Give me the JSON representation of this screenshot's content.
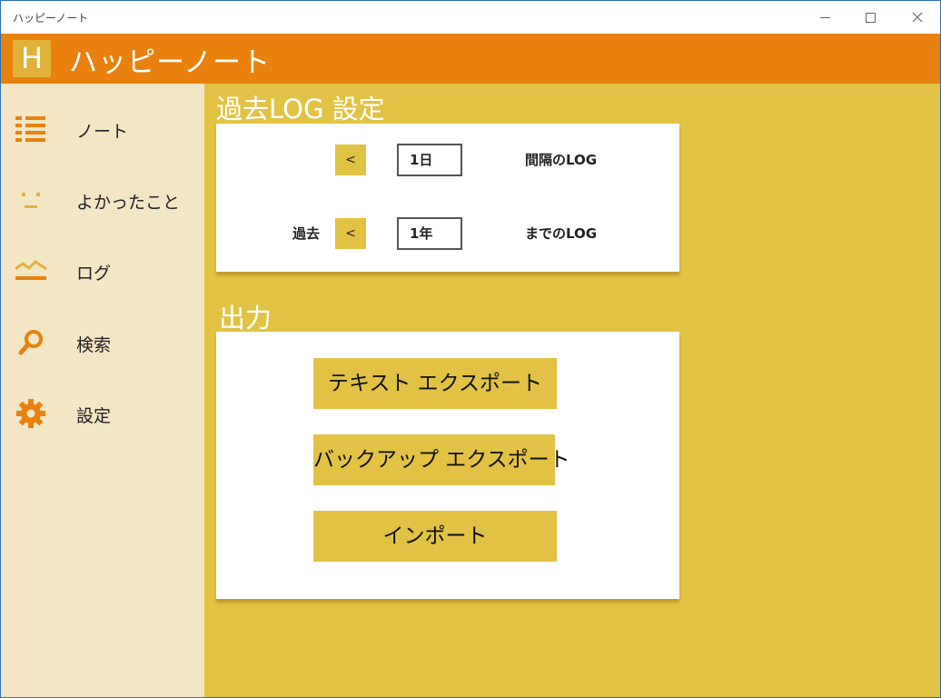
{
  "window": {
    "title": "ハッピーノート"
  },
  "app": {
    "logo_letter": "H",
    "title": "ハッピーノート"
  },
  "sidebar": {
    "items": [
      {
        "label": "ノート",
        "icon": "list-icon"
      },
      {
        "label": "よかったこと",
        "icon": "smile-icon"
      },
      {
        "label": "ログ",
        "icon": "chart-line-icon"
      },
      {
        "label": "検索",
        "icon": "search-icon"
      },
      {
        "label": "設定",
        "icon": "gear-icon"
      }
    ]
  },
  "log_settings": {
    "title": "過去LOG 設定",
    "interval": {
      "button": "<",
      "value": "1日",
      "label": "間隔のLOG"
    },
    "past": {
      "prefix": "過去",
      "button": "<",
      "value": "1年",
      "label": "までのLOG"
    }
  },
  "output": {
    "title": "出力",
    "text_export": "テキスト エクスポート",
    "backup_export": "バックアップ エクスポート",
    "import": "インポート"
  },
  "colors": {
    "header": "#e8810e",
    "accent": "#e1c244",
    "sidebar": "#f3e6c5",
    "icon": "#e8810e"
  }
}
